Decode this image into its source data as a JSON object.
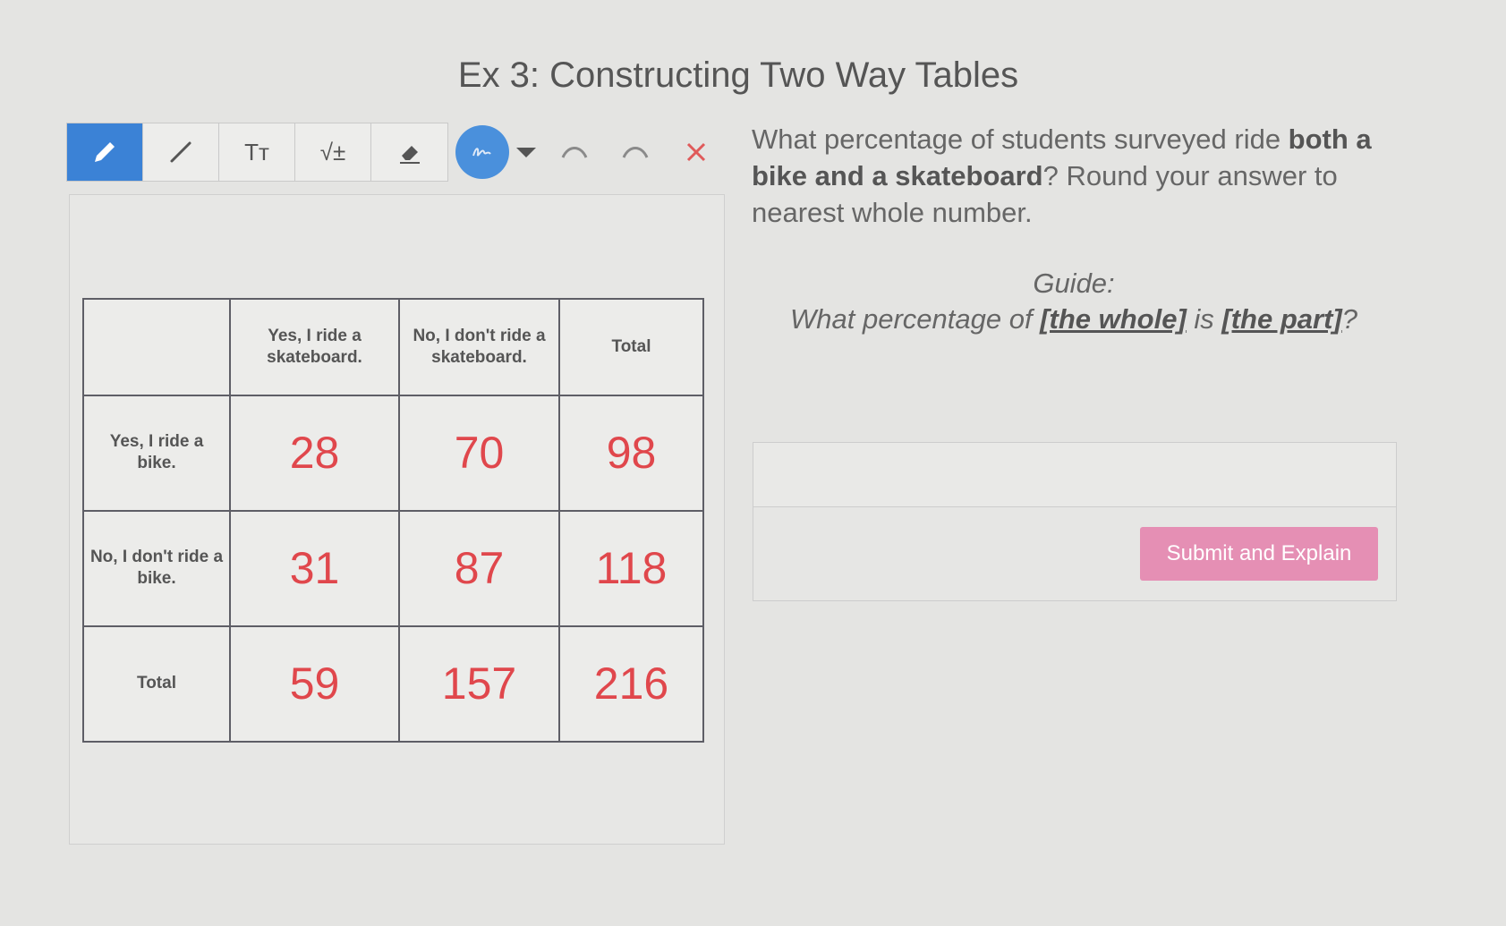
{
  "header": {
    "title": "Ex 3: Constructing Two Way Tables"
  },
  "toolbar": {
    "tools": [
      "pen-icon",
      "line-icon",
      "text-size-icon",
      "math-icon",
      "eraser-icon"
    ],
    "text_tool_glyph": "Tт",
    "math_tool_glyph": "√±",
    "accent_color": "#3b82d6"
  },
  "table": {
    "headers": [
      "",
      "Yes, I ride a skateboard.",
      "No, I don't ride a skateboard.",
      "Total"
    ],
    "rows": [
      {
        "label": "Yes, I ride a bike.",
        "cells": [
          "28",
          "70",
          "98"
        ]
      },
      {
        "label": "No, I don't ride a bike.",
        "cells": [
          "31",
          "87",
          "118"
        ]
      },
      {
        "label": "Total",
        "cells": [
          "59",
          "157",
          "216"
        ]
      }
    ],
    "value_color": "#e0474c"
  },
  "question": {
    "part1": "What percentage of students surveyed ride ",
    "bold": "both a bike and a skateboard",
    "part2": "? Round your answer to nearest whole number."
  },
  "guide": {
    "label": "Guide:",
    "prefix": "What percentage of ",
    "whole": "[the whole]",
    "middle": " is ",
    "part": "[the part]",
    "suffix": "?"
  },
  "answer": {
    "value": "",
    "submit_label": "Submit and Explain",
    "submit_color": "#e58fb4"
  }
}
